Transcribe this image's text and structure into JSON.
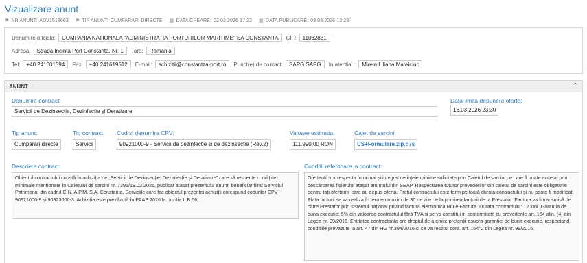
{
  "page": {
    "title": "Vizualizare anunt"
  },
  "meta": [
    {
      "icon": "tag-icon",
      "glyph": "⚑",
      "label": "NR ANUNT:",
      "value": "ADV1518663"
    },
    {
      "icon": "tag-icon",
      "glyph": "⚑",
      "label": "TIP ANUNT:",
      "value": "CUMPARARI DIRECTE"
    },
    {
      "icon": "calendar-icon",
      "glyph": "▦",
      "label": "DATA CREARE:",
      "value": "02.03.2026 17:22"
    },
    {
      "icon": "calendar-icon",
      "glyph": "▦",
      "label": "DATA PUBLICARE:",
      "value": "03.03.2026 13:23"
    }
  ],
  "authority": {
    "name_label": "Denumire oficiala:",
    "name": "COMPANIA NATIONALA \"ADMINISTRATIA PORTURILOR MARITIME\" SA CONSTANTA",
    "cif_label": "CIF:",
    "cif": "11062831",
    "address_label": "Adresa:",
    "address": "Strada Incinta Port Constanta, Nr. 1",
    "country_label": "Tara:",
    "country": "Romania",
    "tel_label": "Tel:",
    "tel": "+40 241601394",
    "fax_label": "Fax:",
    "fax": "+40 241619512",
    "email_label": "E-mail:",
    "email": "achizitii@constantza-port.ro",
    "contact_label": "Punct(e) de contact:",
    "contact": "SAPG SAPG",
    "attention_label": "In atentia: :",
    "attention": "Mirela Liliana Mateiciuc"
  },
  "section": {
    "title": "ANUNT"
  },
  "contract": {
    "name_label": "Denumire contract:",
    "name": "Servicii de Dezinsecție, Dezinfecție și Deratizare",
    "deadline_label": "Data limita depunere oferta:",
    "deadline": "16.03.2026 23:30",
    "type_label": "Tip anunt:",
    "type": "Cumparari directe",
    "contract_type_label": "Tip contract:",
    "contract_type": "Servicii",
    "cpv_label": "Cod si denumire CPV:",
    "cpv": "90921000-9 - Servicii de dezinfectie si de dezinsectie (Rev.2)",
    "value_label": "Valoare estimata:",
    "value": "111.990,00",
    "currency": "RON",
    "specs_label": "Caiet de sarcini:",
    "specs_file": "CS+Formulare.zip.p7s",
    "description_label": "Descriere contract:",
    "description": "Obiectul contractului constă în achiziția de „Servicii de Dezinsecție, Dezinfecție și Deratizare” care să respecte condițiile minimale menționate în Caietului de sarcini nr. 7391/19.02.2026, publicat atasat prezentului anunt, beneficiar fiind Serviciul Patrimoniu din cadrul C.N. A.P.M. S.A. Constanța. Serviciile care fac obiectul prezentei achiziții corespund codurilor CPV 90921000-9 și 90923000-3. Achiziția este prevăzută în PAAS 2026 la pozitia II.B.56.",
    "conditions_label": "Conditii referitoare la contract:",
    "conditions": "Ofertantii vor respecta întocmai și integral cerințele minime solicitate prin Caietul de sarcini pe care îl poate accesa prin descărcarea fișierului atașat anunțului din SEAP. Respectarea tuturor prevederilor din caietul de sarcini este obligatorie pentru toți ofertanții care au depus oferta. Prețul contractului este ferm pe toată durata contractului și nu poate fi modificat. Plata facturii se va realiza în termen maxim de 30 de zile de la primirea facturii de la Prestator. Factura va fi transmisă de către Prestator prin sistemul național privind factura electronica RO e-Factura. Durata contractului: 12 luni. Garantia de buna executie: 5% din valoarea contractului fără TVA si se va constitui in conformitate cu prevederile art. 164 alin. (4) din Legea nr. 99/2016. Entitatea contractanta are dreptul de a emite pretenții asupra garantiei de buna executie, respectand conditiile prevazute la art. 47 din HG nr.394/2016 si se va restitui conf. art. 164^2 din Legea nr. 99/2016."
  }
}
